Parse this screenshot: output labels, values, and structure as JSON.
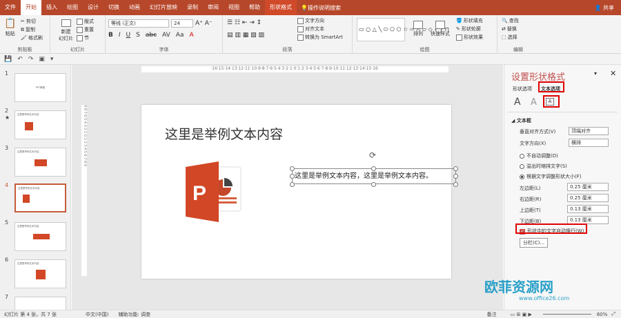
{
  "tabs": [
    "文件",
    "开始",
    "插入",
    "绘图",
    "设计",
    "切换",
    "动画",
    "幻灯片放映",
    "录制",
    "审阅",
    "视图",
    "帮助",
    "形状格式"
  ],
  "tell_me": "操作说明搜索",
  "share": "共享",
  "ribbon": {
    "clipboard": {
      "label": "剪贴板",
      "paste": "粘贴",
      "cut": "剪切",
      "copy": "复制",
      "format_painter": "格式刷"
    },
    "slides": {
      "label": "幻灯片",
      "new_slide": "新建\n幻灯片",
      "layout": "版式",
      "reset": "重置",
      "section": "节"
    },
    "font": {
      "label": "字体",
      "font_name": "等线 (正文)",
      "font_size": "24"
    },
    "paragraph": {
      "label": "段落",
      "text_direction": "文字方向",
      "align_text": "对齐文本",
      "smartart": "转换为 SmartArt"
    },
    "drawing": {
      "label": "绘图",
      "arrange": "排列",
      "quick_styles": "快速样式",
      "fill": "形状填充",
      "outline": "形状轮廓",
      "effects": "形状效果"
    },
    "editing": {
      "label": "编辑",
      "find": "查找",
      "replace": "替换",
      "select": "选择"
    }
  },
  "ruler": "·16·15·14·13·12·11·10·9·8·7·6·5·4·3·2·1·0·1·2·3·4·5·6·7·8·9·10·11·12·13·14·15·16·",
  "vruler": "9·8·7·6·5·4·3·2·1·0·1·2·3·4·5·6·7·8·9",
  "thumbnails": [
    {
      "num": "1",
      "text": "PPT教程",
      "star": ""
    },
    {
      "num": "2",
      "text": "这里是举例文本内容",
      "star": "★"
    },
    {
      "num": "3",
      "text": "这里是举例文本内容",
      "star": ""
    },
    {
      "num": "4",
      "text": "这里是举例文本内容",
      "star": ""
    },
    {
      "num": "5",
      "text": "这里是举例文本内容",
      "star": ""
    },
    {
      "num": "6",
      "text": "这里是举例文本内容",
      "star": ""
    },
    {
      "num": "7",
      "text": "",
      "star": ""
    }
  ],
  "slide": {
    "title": "这里是举例文本内容",
    "textbox": "这里是举例文本内容，这里是举例文本内容。"
  },
  "pane": {
    "title": "设置形状格式",
    "tab_shape": "形状选项",
    "tab_text": "文本选项",
    "section": "文本框",
    "valign_label": "垂直对齐方式(V)",
    "valign_value": "顶端对齐",
    "textdir_label": "文字方向(X)",
    "textdir_value": "横排",
    "radio_none": "不自动调整(D)",
    "radio_shrink": "溢出时缩排文字(S)",
    "radio_resize": "根据文字调整形状大小(F)",
    "left_label": "左边距(L)",
    "left_value": "0.25 厘米",
    "right_label": "右边距(R)",
    "right_value": "0.25 厘米",
    "top_label": "上边距(T)",
    "top_value": "0.13 厘米",
    "bottom_label": "下边距(B)",
    "bottom_value": "0.13 厘米",
    "wrap_label": "形状中的文字自动换行(W)",
    "columns_btn": "分栏(C)..."
  },
  "status": {
    "slide": "幻灯片 第 4 张，共 7 张",
    "lang": "中文(中国)",
    "access": "辅助功能: 调查",
    "notes": "备注",
    "zoom": "60%"
  },
  "watermark": {
    "name": "欧菲资源网",
    "url": "www.office26.com"
  }
}
